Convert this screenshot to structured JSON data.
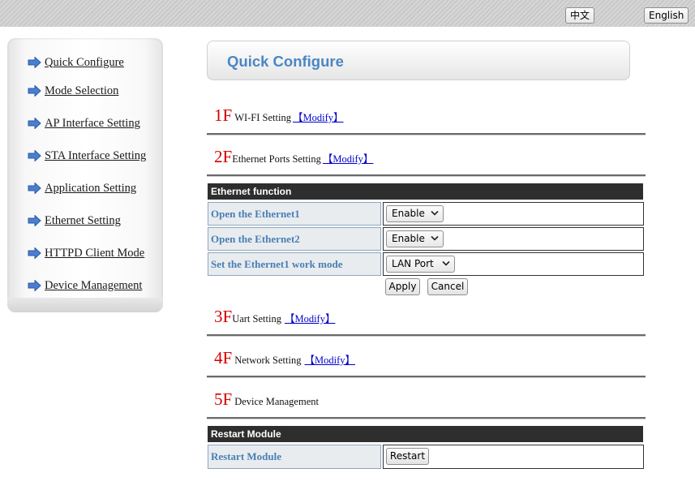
{
  "header": {
    "lang_chinese": "中文",
    "lang_english": "English"
  },
  "sidebar": {
    "items": [
      {
        "label": "Quick Configure"
      },
      {
        "label": "Mode Selection"
      },
      {
        "label": "AP Interface Setting"
      },
      {
        "label": "STA Interface Setting"
      },
      {
        "label": "Application Setting"
      },
      {
        "label": "Ethernet Setting"
      },
      {
        "label": "HTTPD Client Mode"
      },
      {
        "label": "Device Management"
      }
    ]
  },
  "main": {
    "title": "Quick Configure",
    "sections": [
      {
        "floor": "1F",
        "label": "WI-FI Setting",
        "modify": "【Modify】"
      },
      {
        "floor": "2F",
        "label": "Ethernet Ports Setting",
        "modify": "【Modify】"
      },
      {
        "floor": "3F",
        "label": "Uart Setting",
        "modify": "【Modify】"
      },
      {
        "floor": "4F",
        "label": "Network Setting",
        "modify": "【Modify】"
      },
      {
        "floor": "5F",
        "label": "Device Management"
      }
    ],
    "ethernet_table": {
      "header": "Ethernet function",
      "rows": [
        {
          "label": "Open the Ethernet1",
          "value": "Enable"
        },
        {
          "label": "Open the Ethernet2",
          "value": "Enable"
        },
        {
          "label": "Set the Ethernet1 work mode",
          "value": "LAN Port"
        }
      ],
      "apply_label": "Apply",
      "cancel_label": "Cancel"
    },
    "restart_table": {
      "header": "Restart Module",
      "row_label": "Restart Module",
      "button_label": "Restart"
    }
  },
  "colors": {
    "accent_title": "#4a86c4",
    "floor_number": "#d40000",
    "table_header_bg": "#2e2e2e",
    "label_cell_text": "#4a7fb4",
    "link": "#0000cc"
  }
}
